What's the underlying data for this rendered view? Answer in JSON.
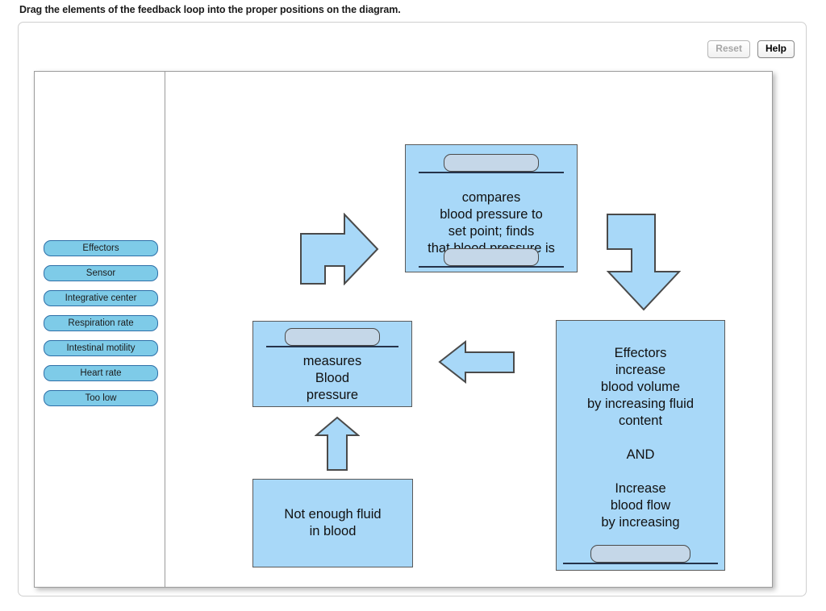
{
  "prompt": "Drag the elements of the feedback loop into the proper positions on the diagram.",
  "toolbar": {
    "reset_label": "Reset",
    "help_label": "Help"
  },
  "palette": {
    "items": [
      {
        "label": "Effectors"
      },
      {
        "label": "Sensor"
      },
      {
        "label": "Integrative center"
      },
      {
        "label": "Respiration rate"
      },
      {
        "label": "Intestinal motility"
      },
      {
        "label": "Heart rate"
      },
      {
        "label": "Too low"
      }
    ]
  },
  "diagram": {
    "boxes": {
      "compare": {
        "text": "compares\nblood pressure to\nset point; finds\nthat blood pressure is",
        "slot_top_value": "",
        "slot_bottom_value": ""
      },
      "measures": {
        "text": "measures\nBlood\npressure",
        "slot_top_value": ""
      },
      "effectors": {
        "text": "Effectors\nincrease\nblood volume\nby increasing fluid\ncontent\n\nAND\n\nIncrease\nblood flow\nby increasing",
        "slot_bottom_value": ""
      },
      "not_enough": {
        "text": "Not enough fluid\nin blood"
      }
    },
    "arrows": [
      {
        "name": "bent-up-right"
      },
      {
        "name": "bent-right-down"
      },
      {
        "name": "left"
      },
      {
        "name": "up"
      }
    ]
  },
  "colors": {
    "box_fill": "#a8d8f8",
    "token_fill": "#7ecbe8",
    "token_border": "#2d6fa8",
    "slot_fill": "#c5d7e8",
    "arrow_fill": "#a8d8f8",
    "arrow_border": "#4a4a4a"
  }
}
